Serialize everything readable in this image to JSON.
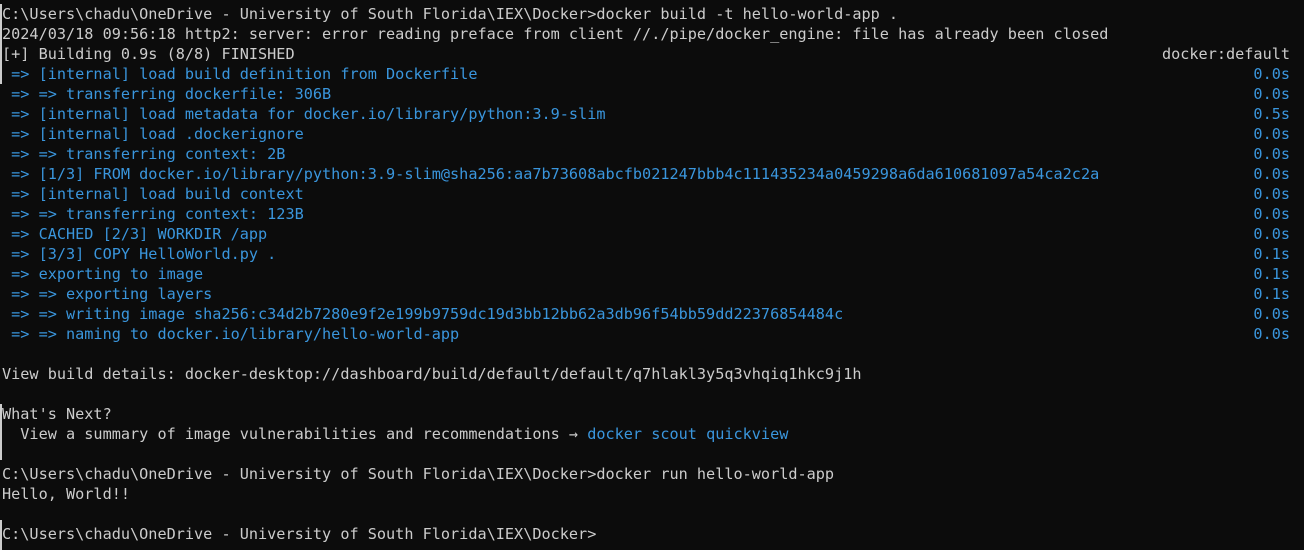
{
  "colors": {
    "background": "#0c0c0c",
    "text": "#cccccc",
    "accent": "#3a96dd"
  },
  "cmd1": "C:\\Users\\chadu\\OneDrive - University of South Florida\\IEX\\Docker>docker build -t hello-world-app .",
  "warn": "2024/03/18 09:56:18 http2: server: error reading preface from client //./pipe/docker_engine: file has already been closed",
  "build_header": {
    "text": "[+] Building 0.9s (8/8) FINISHED",
    "right": "docker:default"
  },
  "steps": [
    {
      "text": " => [internal] load build definition from Dockerfile",
      "time": "0.0s"
    },
    {
      "text": " => => transferring dockerfile: 306B",
      "time": "0.0s"
    },
    {
      "text": " => [internal] load metadata for docker.io/library/python:3.9-slim",
      "time": "0.5s"
    },
    {
      "text": " => [internal] load .dockerignore",
      "time": "0.0s"
    },
    {
      "text": " => => transferring context: 2B",
      "time": "0.0s"
    },
    {
      "text": " => [1/3] FROM docker.io/library/python:3.9-slim@sha256:aa7b73608abcfb021247bbb4c111435234a0459298a6da610681097a54ca2c2a",
      "time": "0.0s"
    },
    {
      "text": " => [internal] load build context",
      "time": "0.0s"
    },
    {
      "text": " => => transferring context: 123B",
      "time": "0.0s"
    },
    {
      "text": " => CACHED [2/3] WORKDIR /app",
      "time": "0.0s"
    },
    {
      "text": " => [3/3] COPY HelloWorld.py .",
      "time": "0.1s"
    },
    {
      "text": " => exporting to image",
      "time": "0.1s"
    },
    {
      "text": " => => exporting layers",
      "time": "0.1s"
    },
    {
      "text": " => => writing image sha256:c34d2b7280e9f2e199b9759dc19d3bb12bb62a3db96f54bb59dd22376854484c",
      "time": "0.0s"
    },
    {
      "text": " => => naming to docker.io/library/hello-world-app",
      "time": "0.0s"
    }
  ],
  "build_details": "View build details: docker-desktop://dashboard/build/default/default/q7hlakl3y5q3vhqiq1hkc9j1h",
  "whats_next": {
    "title": "What's Next?",
    "text": "  View a summary of image vulnerabilities and recommendations → ",
    "command": "docker scout quickview"
  },
  "cmd2": "C:\\Users\\chadu\\OneDrive - University of South Florida\\IEX\\Docker>docker run hello-world-app",
  "output": "Hello, World!!",
  "prompt": "C:\\Users\\chadu\\OneDrive - University of South Florida\\IEX\\Docker>"
}
